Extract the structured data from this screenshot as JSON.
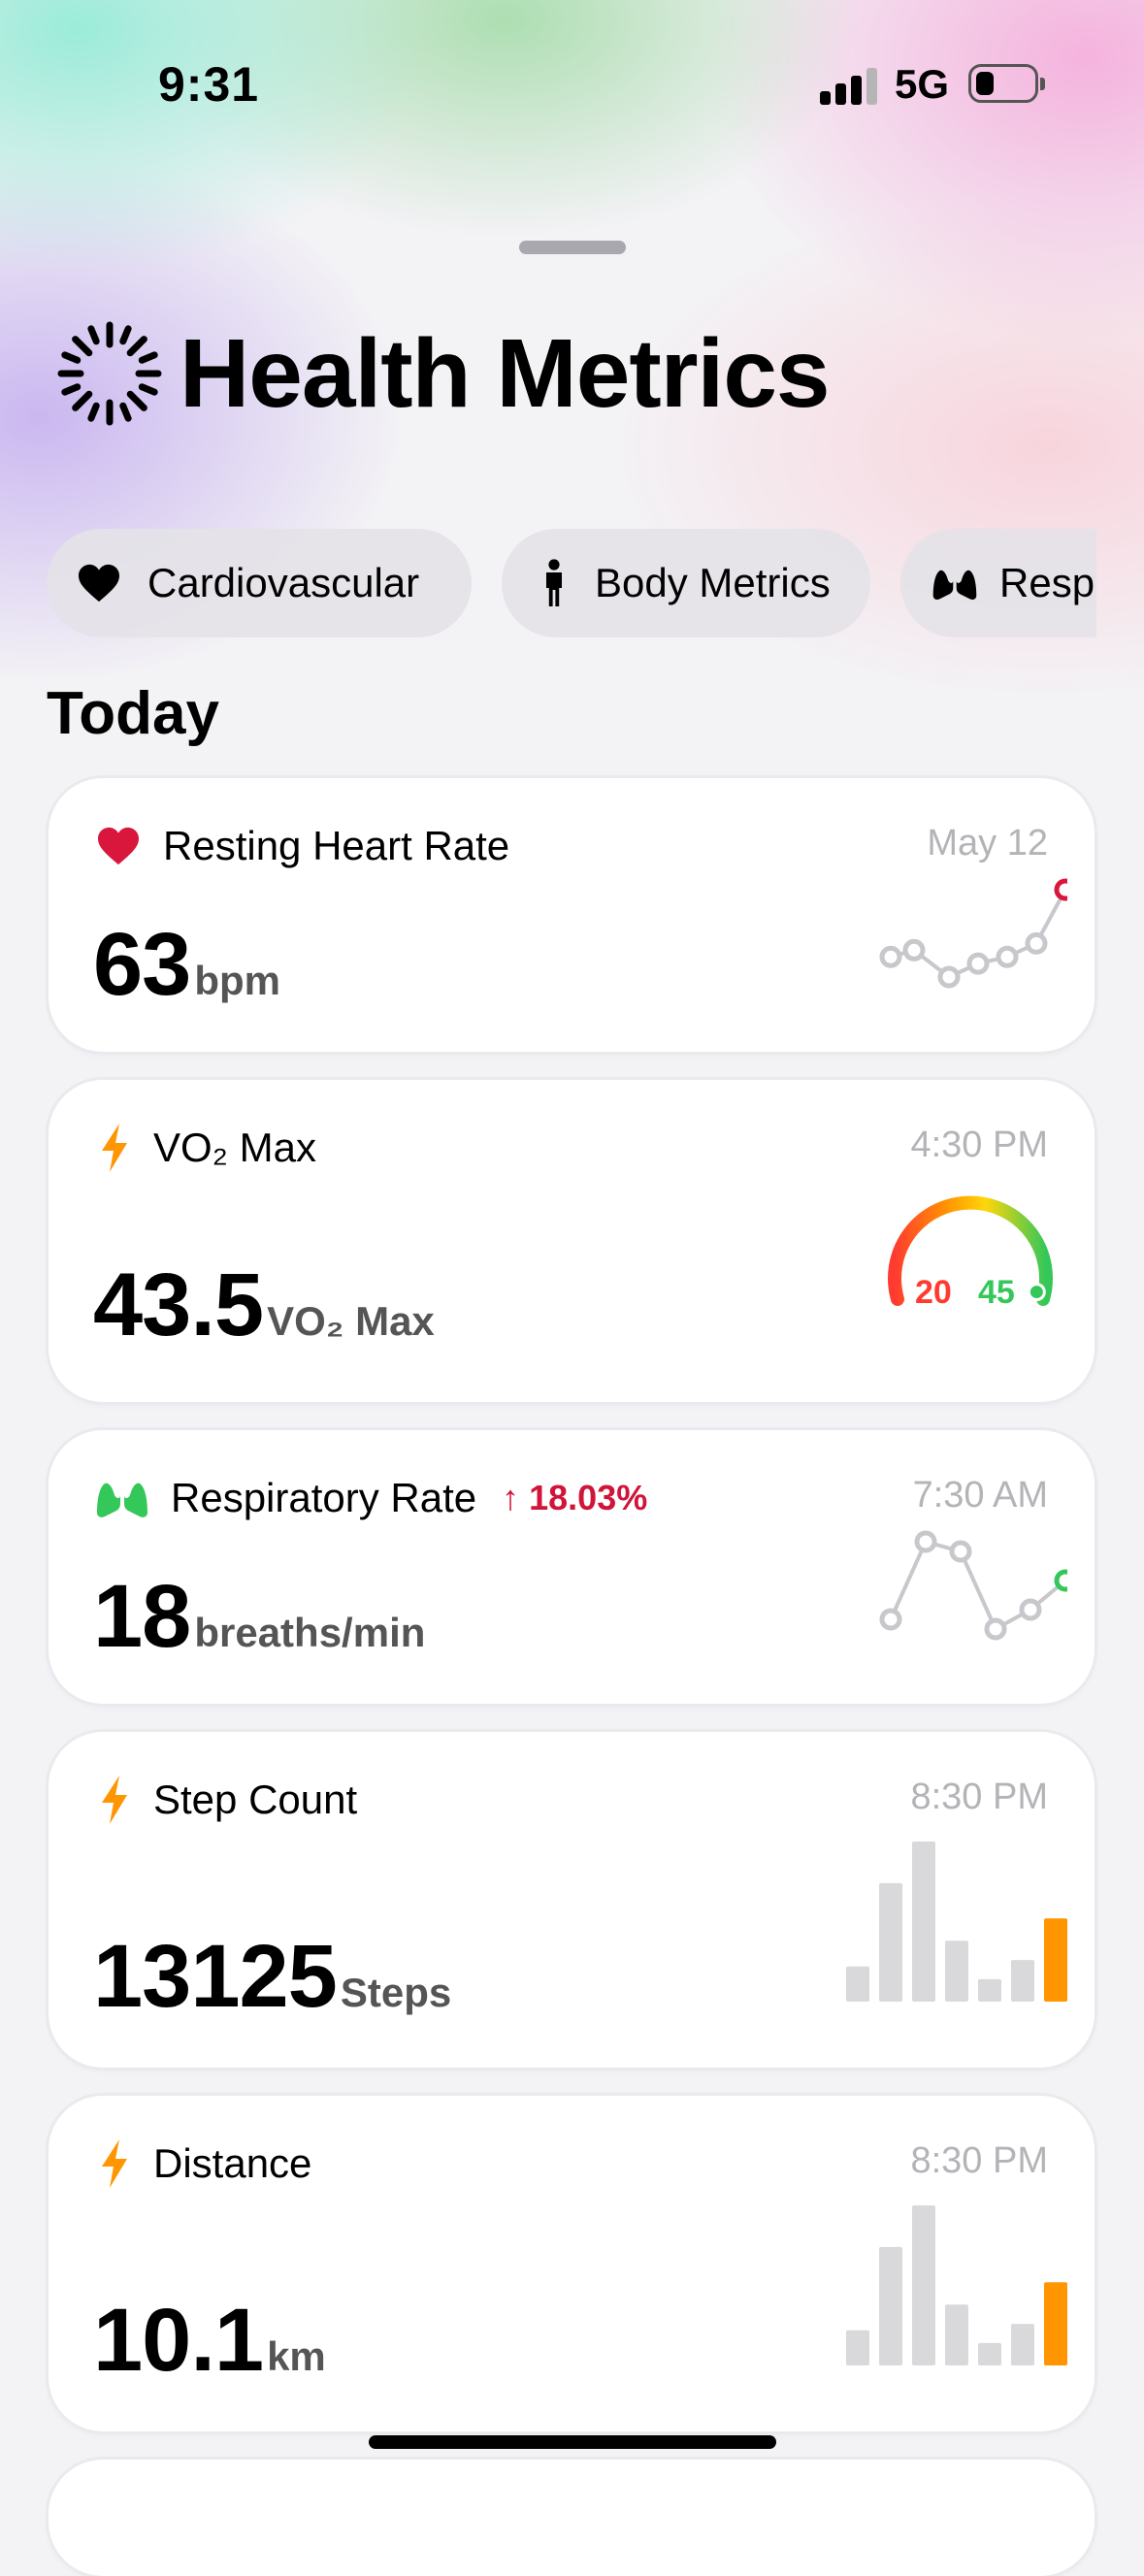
{
  "status_bar": {
    "time": "9:31",
    "network": "5G"
  },
  "header": {
    "title": "Health Metrics"
  },
  "categories": [
    {
      "label": "Cardiovascular",
      "icon": "heart-icon"
    },
    {
      "label": "Body Metrics",
      "icon": "person-icon"
    },
    {
      "label": "Resp",
      "icon": "lungs-icon"
    }
  ],
  "section_title": "Today",
  "cards": {
    "resting_hr": {
      "title": "Resting Heart Rate",
      "date": "May 12",
      "value": "63",
      "unit": "bpm",
      "icon": "heart-icon",
      "color": "#d9173d",
      "trend": [
        60,
        61,
        57,
        59,
        60,
        62,
        70
      ]
    },
    "vo2": {
      "title": "VO₂ Max",
      "date": "4:30 PM",
      "value": "43.5",
      "unit": "VO₂ Max",
      "icon": "bolt-icon",
      "gauge_min": "20",
      "gauge_max": "45",
      "gauge_fraction": 0.94
    },
    "resp": {
      "title": "Respiratory Rate",
      "trend_label": "↑ 18.03%",
      "date": "7:30 AM",
      "value": "18",
      "unit": "breaths/min",
      "icon": "lungs-icon",
      "color": "#34c759",
      "trend": [
        15,
        19,
        18.5,
        14.5,
        15.5,
        17
      ]
    },
    "steps": {
      "title": "Step Count",
      "date": "8:30 PM",
      "value": "13125",
      "unit": "Steps",
      "icon": "bolt-icon",
      "bars": [
        0.22,
        0.74,
        1.0,
        0.38,
        0.14,
        0.26,
        0.52
      ]
    },
    "distance": {
      "title": "Distance",
      "date": "8:30 PM",
      "value": "10.1",
      "unit": "km",
      "icon": "bolt-icon",
      "bars": [
        0.22,
        0.74,
        1.0,
        0.38,
        0.14,
        0.26,
        0.52
      ]
    }
  },
  "colors": {
    "accent_orange": "#ff9500",
    "bar_gray": "#d9d9dc",
    "line_gray": "#c7c7cc",
    "heart_red": "#d9173d",
    "lung_green": "#34c759"
  }
}
